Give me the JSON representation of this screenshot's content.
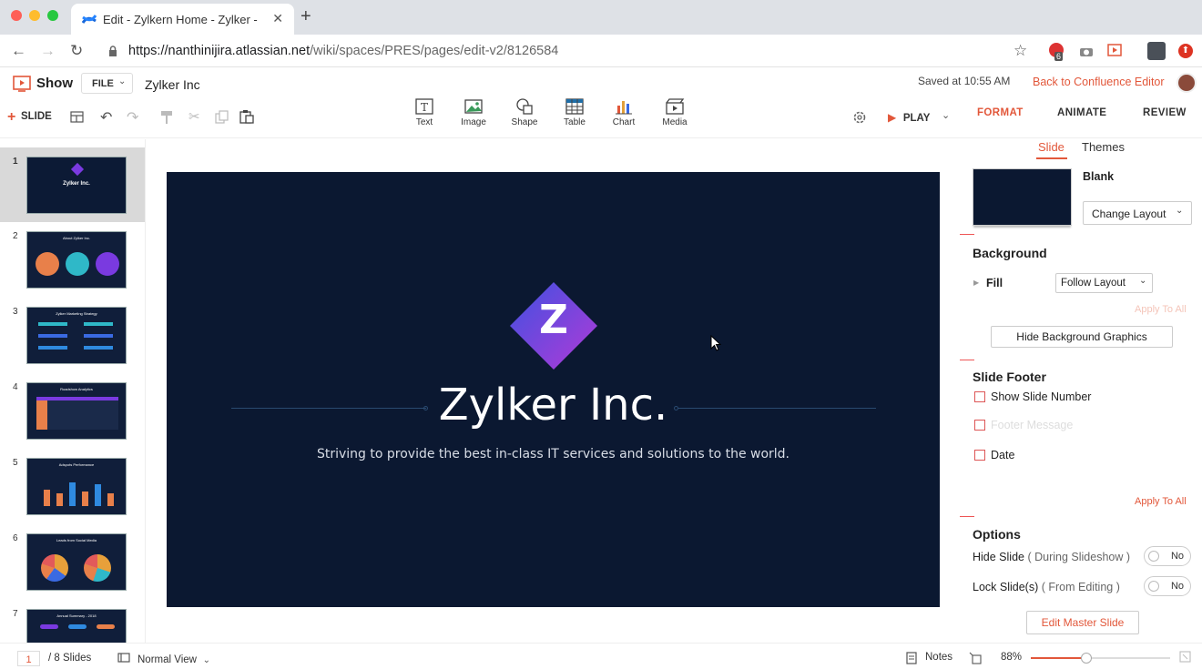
{
  "browser": {
    "tab_title": "Edit - Zylkern Home - Zylker -",
    "url_host": "https://nanthinijira.atlassian.net",
    "url_path": "/wiki/spaces/PRES/pages/edit-v2/8126584",
    "ext_badge": "6"
  },
  "app": {
    "name": "Show",
    "file_menu": "FILE",
    "doc_title": "Zylker Inc",
    "saved_status": "Saved at 10:55 AM",
    "back_link": "Back to Confluence Editor"
  },
  "toolbar": {
    "add_slide": "SLIDE",
    "insert_items": [
      "Text",
      "Image",
      "Shape",
      "Table",
      "Chart",
      "Media"
    ],
    "play": "PLAY",
    "right_tabs": [
      "FORMAT",
      "ANIMATE",
      "REVIEW"
    ]
  },
  "slides": [
    {
      "num": "1",
      "title": "Zylker Inc."
    },
    {
      "num": "2",
      "title": "About Zylker Inc."
    },
    {
      "num": "3",
      "title": "Zylker Marketing Strategy"
    },
    {
      "num": "4",
      "title": "Roadshow Analytics"
    },
    {
      "num": "5",
      "title": "Adspots Performance"
    },
    {
      "num": "6",
      "title": "Leads from Social Media"
    },
    {
      "num": "7",
      "title": "Annual Summary - 2018"
    }
  ],
  "slide": {
    "logo_letter": "Z",
    "title": "Zylker Inc.",
    "subtitle": "Striving to provide the best in-class IT services and solutions to the world."
  },
  "format_panel": {
    "subtabs": [
      "Slide",
      "Themes"
    ],
    "layout_name": "Blank",
    "change_layout": "Change Layout",
    "background_heading": "Background",
    "fill_label": "Fill",
    "fill_value": "Follow Layout",
    "apply_all_disabled": "Apply To All",
    "hide_bg_graphics": "Hide Background Graphics",
    "footer_heading": "Slide Footer",
    "show_slide_number": "Show Slide Number",
    "footer_message": "Footer Message",
    "date": "Date",
    "apply_all": "Apply To All",
    "options_heading": "Options",
    "hide_slide": "Hide Slide",
    "hide_slide_note": "( During Slideshow )",
    "hide_slide_value": "No",
    "lock_slide": "Lock Slide(s)",
    "lock_slide_note": "( From Editing )",
    "lock_slide_value": "No",
    "edit_master": "Edit Master Slide"
  },
  "status": {
    "current_slide": "1",
    "total_slides": "/ 8 Slides",
    "view_mode": "Normal View",
    "notes": "Notes",
    "zoom": "88%",
    "zoom_level": 0.4
  },
  "colors": {
    "accent": "#e2573a",
    "slide_bg": "#0b1831",
    "logo_gradient_start": "#3f51e0",
    "logo_gradient_end": "#b23ad8"
  }
}
